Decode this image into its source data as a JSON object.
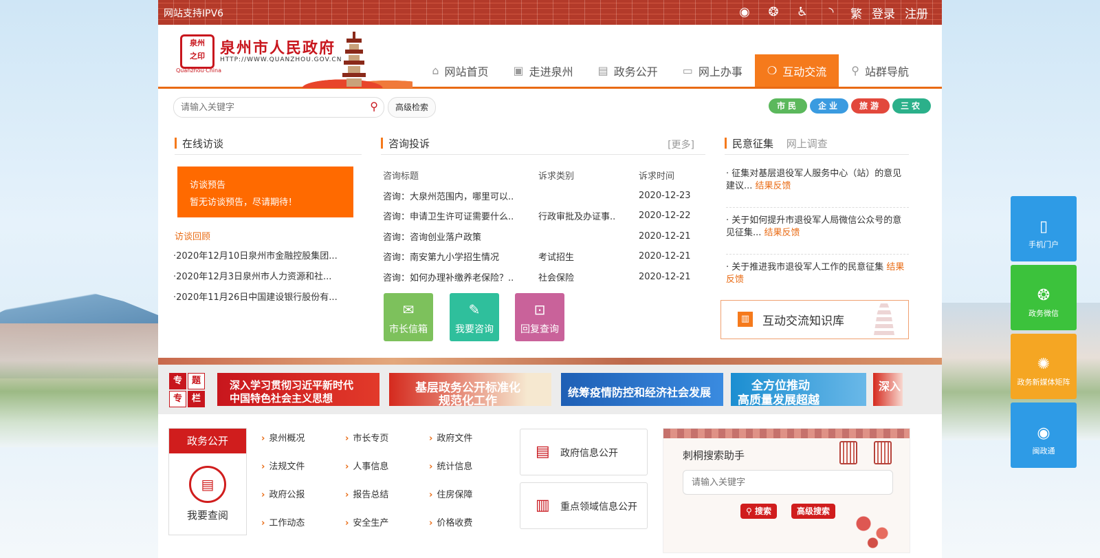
{
  "topbar": {
    "ipv6": "网站支持IPV6",
    "icons": [
      "weibo-icon",
      "wechat-icon",
      "accessibility-icon",
      "rss-icon"
    ],
    "links": [
      "繁",
      "登录",
      "注册"
    ]
  },
  "header": {
    "site_title": "泉州市人民政府",
    "site_url": "HTTP://WWW.QUANZHOU.GOV.CN",
    "logo_sub": "Quanzhou·China",
    "nav": [
      {
        "label": "网站首页",
        "icon": "home-icon"
      },
      {
        "label": "走进泉州",
        "icon": "picture-icon"
      },
      {
        "label": "政务公开",
        "icon": "document-icon"
      },
      {
        "label": "网上办事",
        "icon": "monitor-icon"
      },
      {
        "label": "互动交流",
        "icon": "chat-icon",
        "active": true
      },
      {
        "label": "站群导航",
        "icon": "location-icon"
      }
    ]
  },
  "search": {
    "placeholder": "请输入关键字",
    "advanced": "高级检索",
    "tags": [
      {
        "label": "市民",
        "color": "#5bb85c"
      },
      {
        "label": "企业",
        "color": "#3a9be0"
      },
      {
        "label": "旅游",
        "color": "#e2483c"
      },
      {
        "label": "三农",
        "color": "#2bb08a"
      }
    ]
  },
  "interview": {
    "title": "在线访谈",
    "preview_title": "访谈预告",
    "preview_text": "暂无访谈预告，尽请期待！",
    "review_title": "访谈回顾",
    "reviews": [
      "·2020年12月10日泉州市金融控股集团...",
      "·2020年12月3日泉州市人力资源和社...",
      "·2020年11月26日中国建设银行股份有..."
    ]
  },
  "consult": {
    "title": "咨询投诉",
    "more": "[更多]",
    "headers": [
      "咨询标题",
      "诉求类别",
      "诉求时间"
    ],
    "rows": [
      [
        "咨询：大泉州范围内，哪里可以..",
        "",
        "2020-12-23"
      ],
      [
        "咨询：申请卫生许可证需要什么..",
        "行政审批及办证事..",
        "2020-12-22"
      ],
      [
        "咨询：咨询创业落户政策",
        "",
        "2020-12-21"
      ],
      [
        "咨询：南安第九小学招生情况",
        "考试招生",
        "2020-12-21"
      ],
      [
        "咨询：如何办理补缴养老保险？..",
        "社会保险",
        "2020-12-21"
      ]
    ],
    "buttons": [
      {
        "label": "市长信箱",
        "icon": "mail-icon",
        "color": "#7dc15c"
      },
      {
        "label": "我要咨询",
        "icon": "user-edit-icon",
        "color": "#2fbf9c"
      },
      {
        "label": "回复查询",
        "icon": "search-doc-icon",
        "color": "#c9629a"
      }
    ]
  },
  "opinion": {
    "tab_active": "民意征集",
    "tab_other": "网上调查",
    "items": [
      {
        "text": "· 征集对基层退役军人服务中心（站）的意见建议...",
        "feedback": "结果反馈"
      },
      {
        "text": "· 关于如何提升市退役军人局微信公众号的意见征集...",
        "feedback": "结果反馈"
      },
      {
        "text": "· 关于推进我市退役军人工作的民意征集",
        "feedback": "结果反馈"
      }
    ],
    "kb_label": "互动交流知识库"
  },
  "topics": {
    "badge": [
      "专",
      "题",
      "专",
      "栏"
    ],
    "banners": [
      {
        "line1": "深入学习贯彻习近平新时代",
        "line2": "中国特色社会主义思想",
        "color": "#c8161d"
      },
      {
        "line1": "基层政务公开标准化",
        "line2": "规范化工作",
        "color": "#d52a1e"
      },
      {
        "line1": "统筹疫情防控和经济社会发展",
        "line2": "",
        "color": "#1e5fb5"
      },
      {
        "line1": "全方位推动",
        "line2": "高质量发展超越",
        "color": "#1b8ed1"
      },
      {
        "line1": "深入",
        "line2": "",
        "color": "#d52a1e"
      }
    ]
  },
  "gov": {
    "title": "政务公开",
    "query": "我要查阅",
    "links": [
      "泉州概况",
      "市长专页",
      "政府文件",
      "法规文件",
      "人事信息",
      "统计信息",
      "政府公报",
      "报告总结",
      "住房保障",
      "工作动态",
      "安全生产",
      "价格收费"
    ],
    "info_buttons": [
      {
        "label": "政府信息公开",
        "icon": "doc-list-icon"
      },
      {
        "label": "重点领域信息公开",
        "icon": "tray-icon"
      }
    ]
  },
  "helper": {
    "title": "刺桐搜索助手",
    "placeholder": "请输入关键字",
    "search_btn": "搜索",
    "adv_btn": "高级搜索"
  },
  "floats": [
    {
      "label": "手机门户",
      "icon": "phone-icon",
      "color": "#2e9be6"
    },
    {
      "label": "政务微信",
      "icon": "wechat-icon",
      "color": "#3cc23c"
    },
    {
      "label": "政务新媒体矩阵",
      "icon": "network-icon",
      "color": "#f5a623"
    },
    {
      "label": "闽政通",
      "icon": "eye-icon",
      "color": "#2e9be6"
    }
  ]
}
